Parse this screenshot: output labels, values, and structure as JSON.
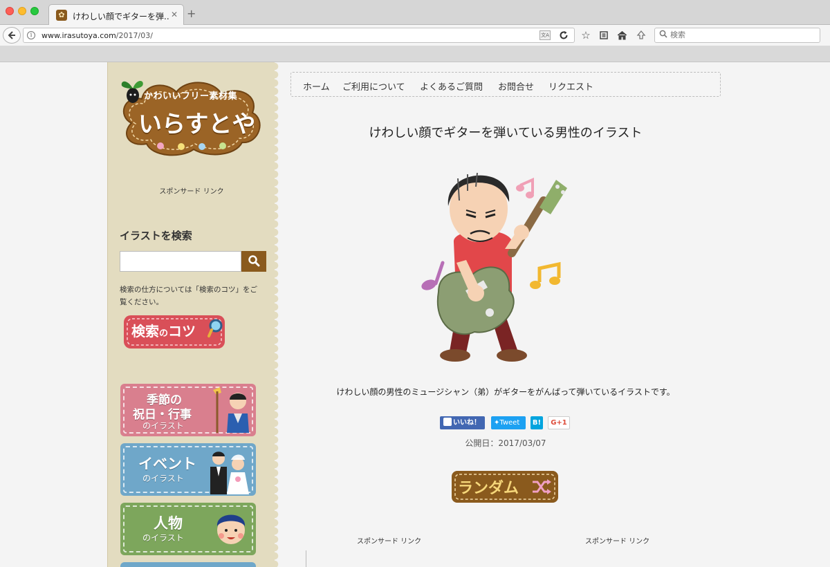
{
  "browser": {
    "tab_title": "けわしい顔でギターを弾...",
    "url_host": "www.irasutoya.com",
    "url_path": "/2017/03/",
    "search_placeholder": "検索"
  },
  "sidebar": {
    "logo": {
      "tagline": "かわいいフリー素材集",
      "name": "いらすとや"
    },
    "sponsored_label": "スポンサード リンク",
    "search_heading": "イラストを検索",
    "search_value": "",
    "search_help": "検索の仕方については「検索のコツ」をご覧ください。",
    "tips_badge": {
      "text_main": "検索",
      "text_small": "の",
      "text_end": "コツ"
    },
    "categories": [
      {
        "line1": "季節の",
        "line2": "祝日・行事",
        "sub": "のイラスト",
        "color": "#d97f8e"
      },
      {
        "line1": "イベント",
        "line2": "",
        "sub": "のイラスト",
        "color": "#6fa7c9"
      },
      {
        "line1": "人物",
        "line2": "",
        "sub": "のイラスト",
        "color": "#7da65c"
      }
    ]
  },
  "nav": {
    "items": [
      "ホーム",
      "ご利用について",
      "よくあるご質問",
      "お問合せ",
      "リクエスト"
    ]
  },
  "post": {
    "title": "けわしい顔でギターを弾いている男性のイラスト",
    "description": "けわしい顔の男性のミュージシャン（弟）がギターをがんばって弾いているイラストです。",
    "published_label": "公開日：2017/03/07"
  },
  "share": {
    "like": "いいね！",
    "tweet": "Tweet",
    "hatena": "B!",
    "gplus": "G+1"
  },
  "random_label": "ランダム",
  "sponsored_left": "スポンサード リンク",
  "sponsored_right": "スポンサード リンク",
  "colors": {
    "brand_brown": "#8a5a1d",
    "sidebar_bg": "#e3dcc0",
    "facebook": "#4267b2",
    "twitter": "#1da1f2",
    "hatena": "#00a4de"
  }
}
